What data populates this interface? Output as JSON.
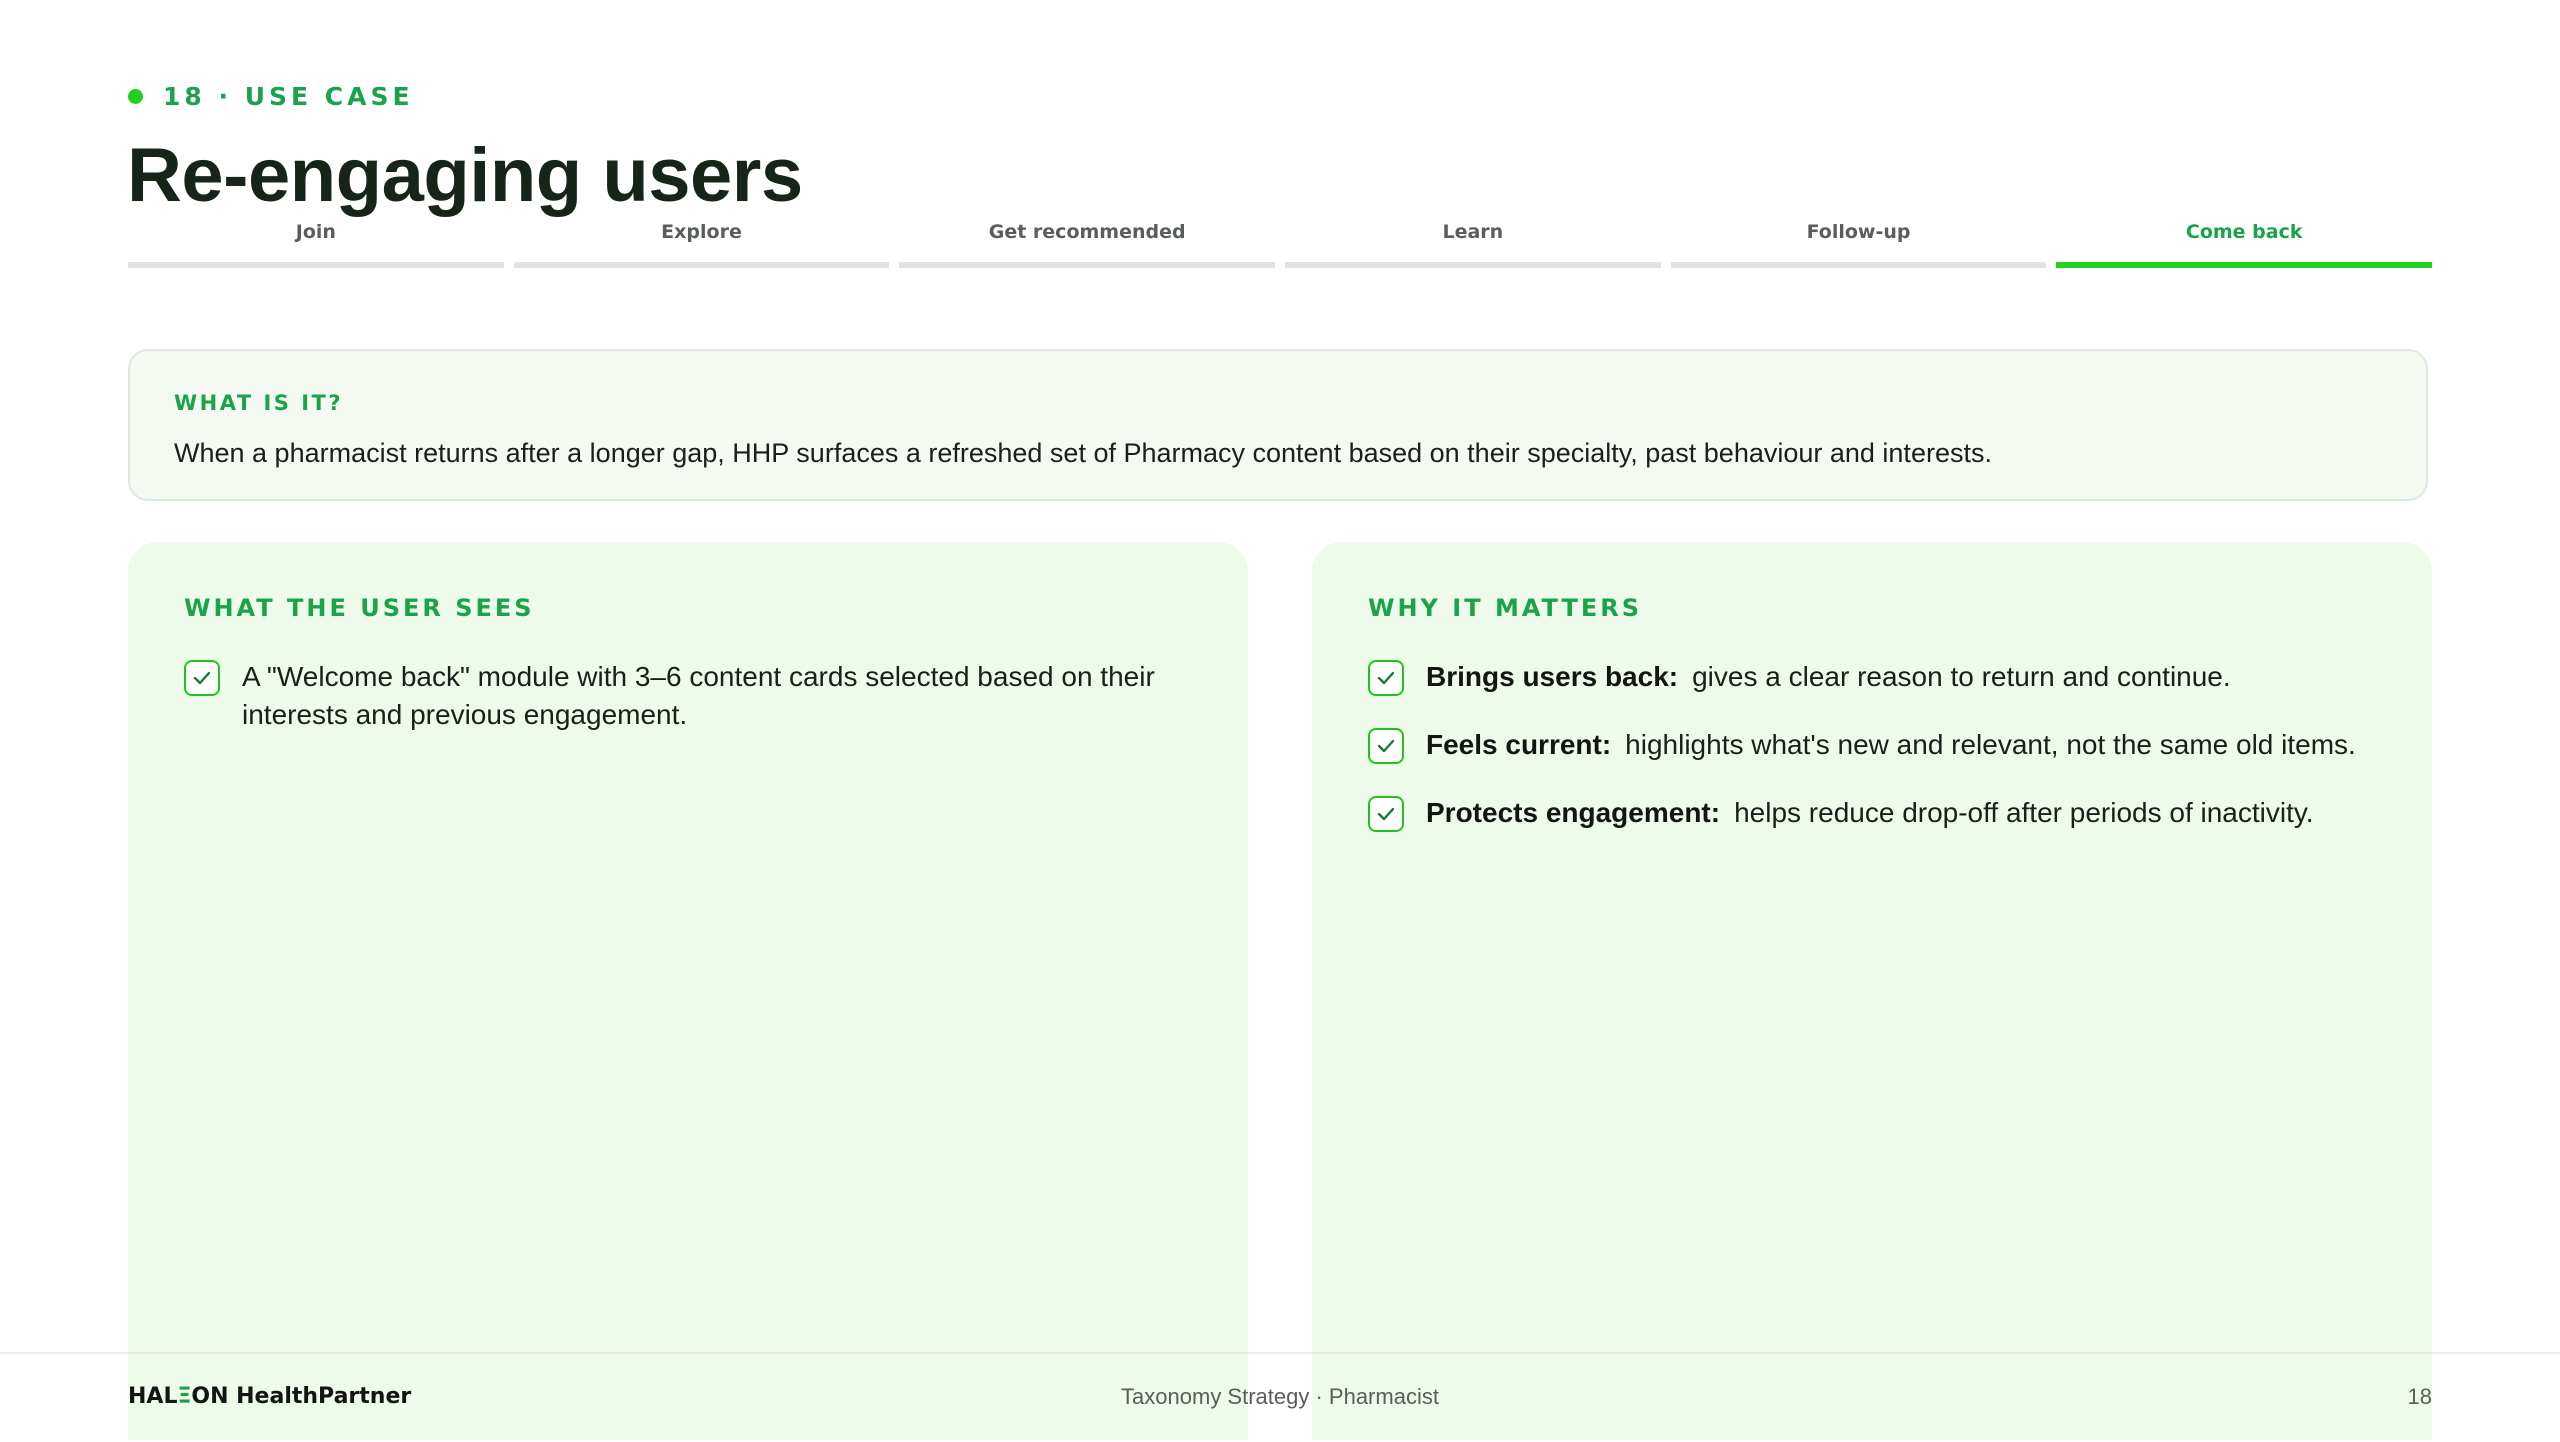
{
  "header": {
    "kicker": "18 · USE CASE",
    "title": "Re-engaging users"
  },
  "steps": [
    {
      "label": "Join",
      "active": false
    },
    {
      "label": "Explore",
      "active": false
    },
    {
      "label": "Get recommended",
      "active": false
    },
    {
      "label": "Learn",
      "active": false
    },
    {
      "label": "Follow-up",
      "active": false
    },
    {
      "label": "Come back",
      "active": true
    }
  ],
  "definition": {
    "label": "WHAT IS IT?",
    "text": "When a pharmacist returns after a longer gap, HHP surfaces a refreshed set of Pharmacy content based on their specialty, past behaviour and interests."
  },
  "user_sees": {
    "label": "WHAT THE USER SEES",
    "items": [
      "A \"Welcome back\" module with 3–6 content cards selected based on their interests and previous engagement."
    ]
  },
  "why_matters": {
    "label": "WHY IT MATTERS",
    "items": [
      {
        "title": "Brings users back:",
        "text": "gives a clear reason to return and continue."
      },
      {
        "title": "Feels current:",
        "text": "highlights what's new and relevant, not the same old items."
      },
      {
        "title": "Protects engagement:",
        "text": "helps reduce drop-off after periods of inactivity."
      }
    ]
  },
  "footer": {
    "brand_left": "HAL",
    "brand_mark": "Ξ",
    "brand_right": "ON HealthPartner",
    "center": "Taxonomy Strategy · Pharmacist",
    "page": "18"
  },
  "colors": {
    "accent": "#1aa34a",
    "accent_bright": "#22d11e",
    "panel_bg": "#eefaea",
    "card_bg": "#f4f9f2"
  }
}
